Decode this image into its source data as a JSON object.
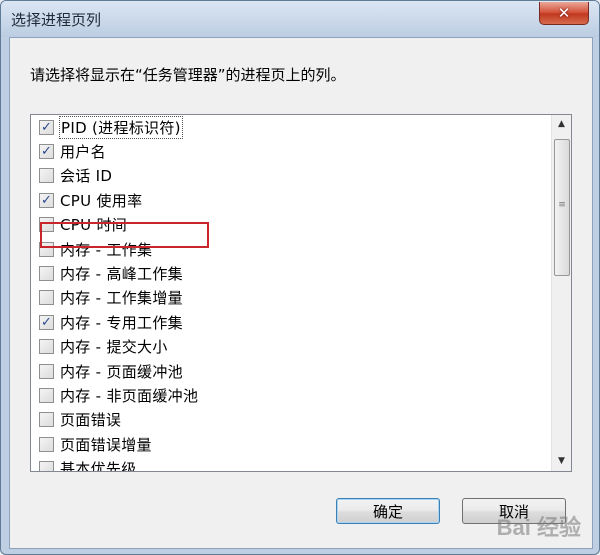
{
  "window": {
    "title": "选择进程页列",
    "close_glyph": "✕"
  },
  "instruction": "请选择将显示在“任务管理器”的进程页上的列。",
  "columns": [
    {
      "label": "PID (进程标识符)",
      "checked": true
    },
    {
      "label": "用户名",
      "checked": true
    },
    {
      "label": "会话 ID",
      "checked": false
    },
    {
      "label": "CPU 使用率",
      "checked": true
    },
    {
      "label": "CPU 时间",
      "checked": false
    },
    {
      "label": "内存 - 工作集",
      "checked": false
    },
    {
      "label": "内存 - 高峰工作集",
      "checked": false
    },
    {
      "label": "内存 - 工作集增量",
      "checked": false
    },
    {
      "label": "内存 - 专用工作集",
      "checked": true
    },
    {
      "label": "内存 - 提交大小",
      "checked": false
    },
    {
      "label": "内存 - 页面缓冲池",
      "checked": false
    },
    {
      "label": "内存 - 非页面缓冲池",
      "checked": false
    },
    {
      "label": "页面错误",
      "checked": false
    },
    {
      "label": "页面错误增量",
      "checked": false
    },
    {
      "label": "基本优先级",
      "checked": false
    }
  ],
  "scrollbar": {
    "up_glyph": "▲",
    "down_glyph": "▼",
    "grip_glyph": "≡"
  },
  "buttons": {
    "ok": "确定",
    "cancel": "取消"
  },
  "watermark": "Bai 经验",
  "colors": {
    "highlight": "#c8262b",
    "check": "#2b4a8f"
  }
}
